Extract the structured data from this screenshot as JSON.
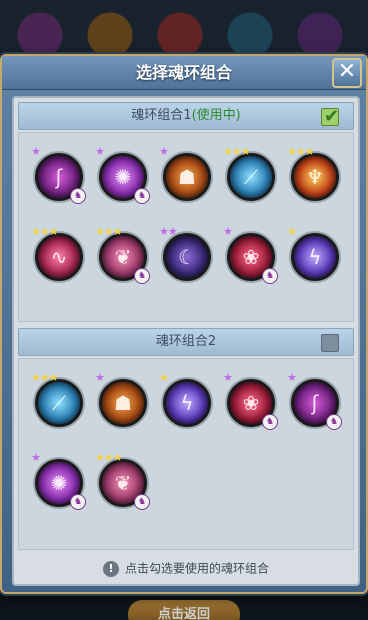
{
  "background": {
    "bottom_button_label": "点击返回"
  },
  "modal": {
    "title": "选择魂环组合",
    "close_glyph": "✕"
  },
  "groups": [
    {
      "label": "魂环组合1",
      "status": "(使用中)",
      "checked": true,
      "rings": [
        {
          "color": "purple",
          "stars": "★",
          "star_color": "purple",
          "badge": true,
          "icon": "tentacle-icon"
        },
        {
          "color": "violet",
          "stars": "★",
          "star_color": "purple",
          "badge": true,
          "icon": "spiky-flower-icon"
        },
        {
          "color": "orange",
          "stars": "★",
          "star_color": "purple",
          "badge": false,
          "icon": "golem-icon"
        },
        {
          "color": "blue",
          "stars": "★★★",
          "star_color": "gold",
          "badge": false,
          "icon": "blade-icon"
        },
        {
          "color": "fire",
          "stars": "★★★",
          "star_color": "gold",
          "badge": false,
          "icon": "demon-mask-icon"
        },
        {
          "color": "pink",
          "stars": "★★★",
          "star_color": "gold",
          "badge": false,
          "icon": "serpent-icon"
        },
        {
          "color": "rose",
          "stars": "★★★",
          "star_color": "gold",
          "badge": true,
          "icon": "beast-icon"
        },
        {
          "color": "dark",
          "stars": "★★",
          "star_color": "purple",
          "badge": false,
          "icon": "dragon-icon"
        },
        {
          "color": "crimson",
          "stars": "★",
          "star_color": "purple",
          "badge": true,
          "icon": "bud-icon"
        },
        {
          "color": "light",
          "stars": "★",
          "star_color": "gold",
          "badge": false,
          "icon": "lightning-icon"
        }
      ]
    },
    {
      "label": "魂环组合2",
      "status": "",
      "checked": false,
      "rings": [
        {
          "color": "blue",
          "stars": "★★★",
          "star_color": "gold",
          "badge": false,
          "icon": "blade-icon"
        },
        {
          "color": "orange",
          "stars": "★",
          "star_color": "purple",
          "badge": false,
          "icon": "golem-icon"
        },
        {
          "color": "light",
          "stars": "★",
          "star_color": "gold",
          "badge": false,
          "icon": "lightning-icon"
        },
        {
          "color": "crimson",
          "stars": "★",
          "star_color": "purple",
          "badge": true,
          "icon": "bud-icon"
        },
        {
          "color": "purple",
          "stars": "★",
          "star_color": "purple",
          "badge": true,
          "icon": "tentacle-icon"
        },
        {
          "color": "violet",
          "stars": "★",
          "star_color": "purple",
          "badge": true,
          "icon": "spiky-flower-icon"
        },
        {
          "color": "rose",
          "stars": "★★★",
          "star_color": "gold",
          "badge": true,
          "icon": "beast-icon"
        }
      ]
    }
  ],
  "hint": {
    "icon_glyph": "!",
    "text": "点击勾选要使用的魂环组合"
  }
}
